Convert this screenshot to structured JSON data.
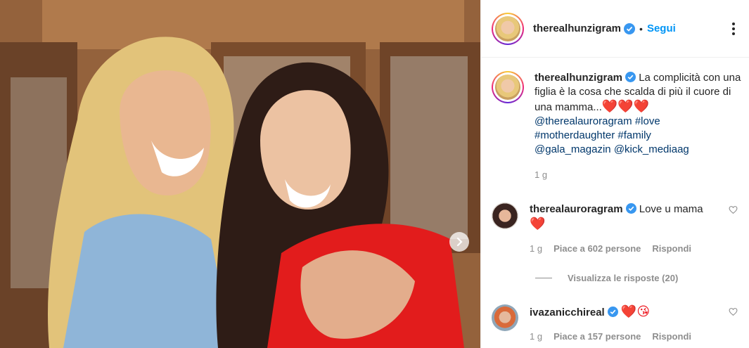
{
  "post": {
    "username": "therealhunzigram",
    "follow_label": "Segui",
    "separator": "•",
    "caption": {
      "text": "La complicità con una figlia è la cosa che scalda di più il cuore di una mamma...",
      "emojis": "❤️❤️❤️",
      "tags": [
        "@therealauroragram",
        "#love",
        "#motherdaughter",
        "#family",
        "@gala_magazin",
        "@kick_mediaag"
      ],
      "time": "1 g"
    }
  },
  "comments": [
    {
      "username": "therealauroragram",
      "text": "Love u mama",
      "emoji": "❤️",
      "time": "1 g",
      "likes": "Piace a 602 persone",
      "reply_label": "Rispondi"
    },
    {
      "username": "ivazanicchireal",
      "text": "",
      "emoji": "❤️😘",
      "time": "1 g",
      "likes": "Piace a 157 persone",
      "reply_label": "Rispondi"
    }
  ],
  "view_replies": "Visualizza le risposte (20)",
  "colors": {
    "accent": "#0095f6",
    "tag": "#00376b",
    "muted": "#8e8e8e",
    "verified": "#3897f0"
  }
}
